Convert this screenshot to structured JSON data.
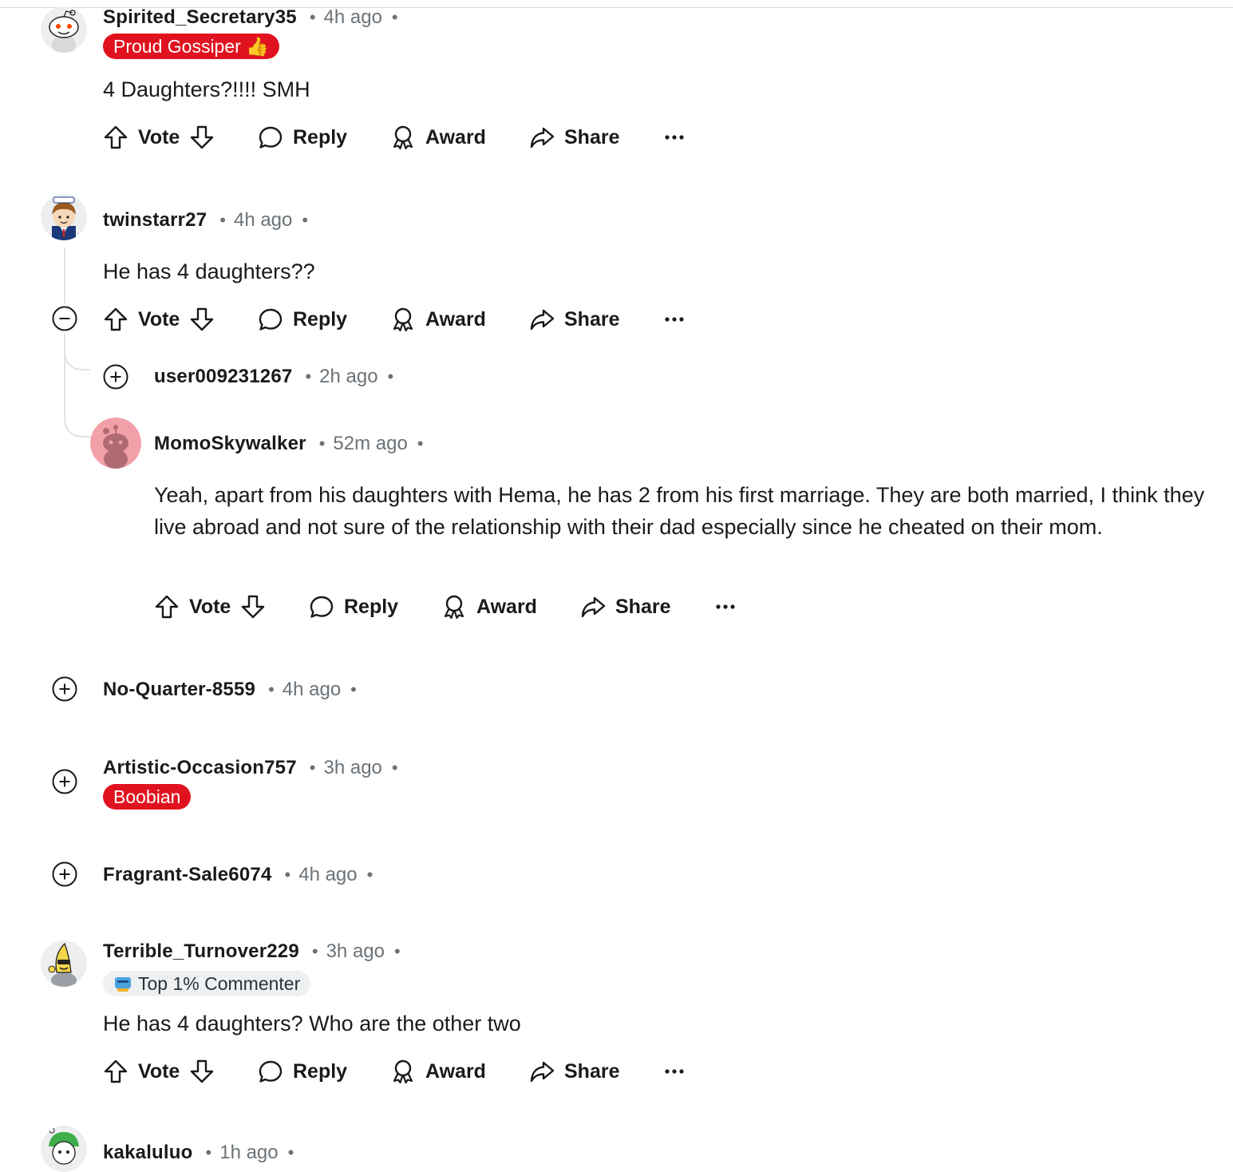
{
  "comments": [
    {
      "author": "Spirited_Secretary35",
      "time": "4h ago",
      "flair": "Proud Gossiper 👍",
      "body": "4 Daughters?!!!! SMH",
      "actions": {
        "vote": "Vote",
        "reply": "Reply",
        "award": "Award",
        "share": "Share",
        "more": "•••"
      }
    },
    {
      "author": "twinstarr27",
      "time": "4h ago",
      "body": "He has 4 daughters??",
      "actions": {
        "vote": "Vote",
        "reply": "Reply",
        "award": "Award",
        "share": "Share",
        "more": "•••"
      },
      "state": "expanded",
      "replies": [
        {
          "author": "user009231267",
          "time": "2h ago",
          "state": "collapsed"
        },
        {
          "author": "MomoSkywalker",
          "time": "52m ago",
          "body": "Yeah, apart from his daughters with Hema, he has 2 from his first marriage. They are both married, I think they live abroad and not sure of the relationship with their dad especially since he cheated on their mom.",
          "actions": {
            "vote": "Vote",
            "reply": "Reply",
            "award": "Award",
            "share": "Share",
            "more": "•••"
          }
        }
      ]
    },
    {
      "author": "No-Quarter-8559",
      "time": "4h ago",
      "state": "collapsed"
    },
    {
      "author": "Artistic-Occasion757",
      "time": "3h ago",
      "flair": "Boobian",
      "state": "collapsed"
    },
    {
      "author": "Fragrant-Sale6074",
      "time": "4h ago",
      "state": "collapsed"
    },
    {
      "author": "Terrible_Turnover229",
      "time": "3h ago",
      "flair": "Top 1% Commenter",
      "body": "He has 4 daughters? Who are the other two",
      "actions": {
        "vote": "Vote",
        "reply": "Reply",
        "award": "Award",
        "share": "Share",
        "more": "•••"
      }
    },
    {
      "author": "kakaluluo",
      "time": "1h ago"
    }
  ],
  "colors": {
    "flair_red": "#e0121f",
    "text": "#1a1a1b",
    "muted": "#6b7277",
    "thread_line": "#e1e3e5"
  },
  "icons": [
    "upvote-icon",
    "downvote-icon",
    "reply-bubble-icon",
    "award-icon",
    "share-icon",
    "more-icon",
    "collapse-icon",
    "expand-icon"
  ]
}
